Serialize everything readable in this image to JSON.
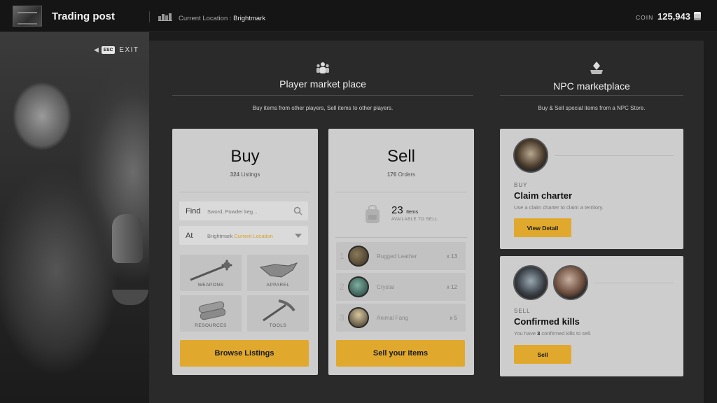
{
  "header": {
    "title": "Trading post",
    "location_label": "Current Location : ",
    "location_value": "Brightmark",
    "coin_label": "COIN",
    "coin_value": "125,943"
  },
  "exit": {
    "key": "ESC",
    "label": "EXIT"
  },
  "player_market": {
    "title": "Player market place",
    "description": "Buy items from other players, Sell items to other players.",
    "buy": {
      "title": "Buy",
      "count": "324",
      "count_label": "Listings",
      "find_label": "Find",
      "find_placeholder": "Sword, Powder keg...",
      "at_label": "At",
      "at_value": "Brightmark",
      "at_value_highlight": "Current Location",
      "categories": [
        {
          "label": "WEAPONS",
          "icon": "mace-icon"
        },
        {
          "label": "APPAREL",
          "icon": "cloth-icon"
        },
        {
          "label": "RESOURCES",
          "icon": "logs-icon"
        },
        {
          "label": "TOOLS",
          "icon": "pickaxe-icon"
        }
      ],
      "button": "Browse Listings"
    },
    "sell": {
      "title": "Sell",
      "count": "176",
      "count_label": "Orders",
      "available_count": "23",
      "available_unit": "Items",
      "available_label": "AVAILABLE TO SELL",
      "items": [
        {
          "index": "1",
          "name": "Rugged Leather",
          "qty": "x 13"
        },
        {
          "index": "2",
          "name": "Crystal",
          "qty": "x 12"
        },
        {
          "index": "3",
          "name": "Animal Fang",
          "qty": "x 5"
        }
      ],
      "button": "Sell your items"
    }
  },
  "npc_market": {
    "title": "NPC marketplace",
    "description": "Buy & Sell special items from a NPC Store.",
    "charter": {
      "kicker": "BUY",
      "title": "Claim charter",
      "description": "Use a claim charter to claim a territory.",
      "button": "View Detail"
    },
    "kills": {
      "kicker": "SELL",
      "title": "Confirmed kills",
      "description_pre": "You have ",
      "description_count": "3",
      "description_post": " confirmed kills to sell.",
      "button": "Sell"
    }
  },
  "colors": {
    "accent": "#e0a92d",
    "panel": "#2a2a2a",
    "card": "#cdcdcd"
  }
}
